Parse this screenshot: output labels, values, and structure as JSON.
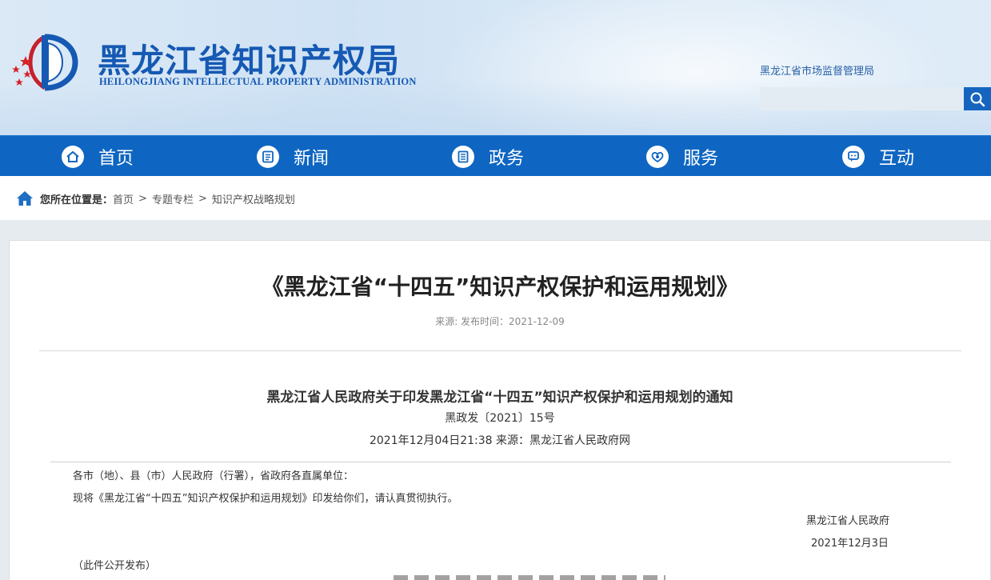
{
  "header": {
    "site_title_cn": "黑龙江省知识产权局",
    "site_title_en": "HEILONGJIANG INTELLECTUAL PROPERTY ADMINISTRATION",
    "top_link": "黑龙江省市场监督管理局",
    "search": {
      "placeholder": "",
      "icon": "search-icon"
    },
    "brand_color": "#1559b3"
  },
  "nav": {
    "background": "#0f66c2",
    "items": [
      {
        "label": "首页",
        "icon": "home-icon"
      },
      {
        "label": "新闻",
        "icon": "news-icon"
      },
      {
        "label": "政务",
        "icon": "government-icon"
      },
      {
        "label": "服务",
        "icon": "service-icon"
      },
      {
        "label": "互动",
        "icon": "interaction-icon"
      }
    ]
  },
  "breadcrumb": {
    "icon": "home-icon",
    "label": "您所在位置是：",
    "items": [
      "首页",
      "专题专栏",
      "知识产权战略规划"
    ],
    "separator": ">"
  },
  "article": {
    "title": "《黑龙江省“十四五”知识产权保护和运用规划》",
    "meta": "来源: 发布时间：2021-12-09",
    "notice_title": "黑龙江省人民政府关于印发黑龙江省“十四五”知识产权保护和运用规划的通知",
    "doc_number": "黑政发〔2021〕15号",
    "dateline": "2021年12月04日21:38  来源：黑龙江省人民政府网",
    "salutation": "各市（地）、县（市）人民政府（行署），省政府各直属单位：",
    "body": "现将《黑龙江省“十四五”知识产权保护和运用规划》印发给你们，请认真贯彻执行。",
    "signature_org": "黑龙江省人民政府",
    "signature_date": "2021年12月3日",
    "publish_note": "（此件公开发布）"
  }
}
